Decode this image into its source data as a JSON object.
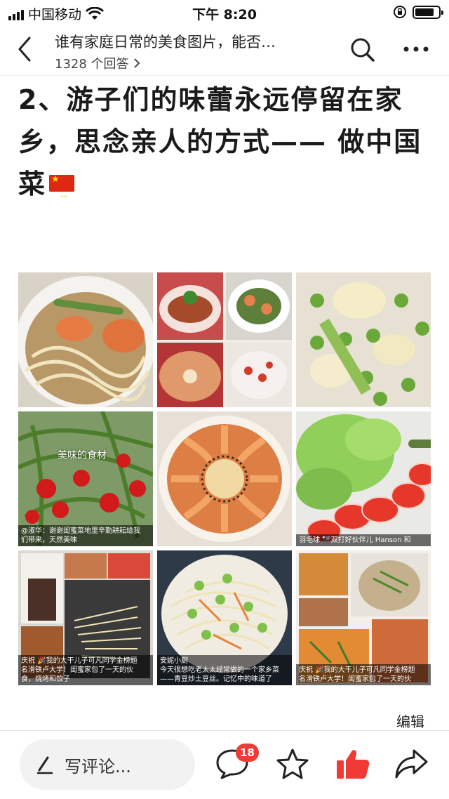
{
  "status_bar": {
    "carrier": "中国移动",
    "time": "下午 8:20"
  },
  "header": {
    "question_title": "谁有家庭日常的美食图片，能否…",
    "answer_count": "1328 个回答",
    "icons": [
      "back-icon",
      "search-icon",
      "more-icon"
    ]
  },
  "answer": {
    "heading": "2、游子们的味蕾永远停留在家乡，思念亲人的方式—— 做中国菜",
    "flag_icon": "china-flag-icon",
    "images": [
      {
        "desc": "shrimp noodle soup",
        "caption": []
      },
      {
        "desc": "four-dish collage",
        "caption": []
      },
      {
        "desc": "stir-fried edamame",
        "caption": []
      },
      {
        "desc": "garden vegetables with chili peppers",
        "watermark": "美味的食材",
        "caption": [
          "@淑华：谢谢闺蜜菜地里辛勤耕耘给我",
          "们带来，天然美味"
        ]
      },
      {
        "desc": "steamed shrimp platter",
        "caption": []
      },
      {
        "desc": "lettuce and tomato salad",
        "caption": [
          "羽毛球 🏸双打好伙伴儿 Hanson 和"
        ]
      },
      {
        "desc": "collage with sauce bottle",
        "caption": [
          "庆祝 🎉我的大干儿子可凡同学金榜题",
          "名滑铁卢大学！闺蜜家包了一天的伙",
          "食，烧烤和饺子"
        ]
      },
      {
        "desc": "edamame and potato shreds",
        "caption": [
          "安妮小厨",
          "今天很想吃老太太经常做的一个家乡菜",
          "——青豆炒土豆丝。记忆中的味道了"
        ]
      },
      {
        "desc": "dishes collage",
        "caption": [
          "庆祝 🎉我的大干儿子可凡同学金榜题",
          "名滑铁卢大学！闺蜜家包了一天的伙"
        ]
      }
    ],
    "edit_label": "编辑"
  },
  "bottom_bar": {
    "comment_placeholder": "写评论...",
    "comment_count": "18",
    "icons": [
      "pen-icon",
      "comment-icon",
      "star-icon",
      "thumbs-up-icon",
      "share-icon"
    ],
    "accent_color": "#ef3a35"
  }
}
